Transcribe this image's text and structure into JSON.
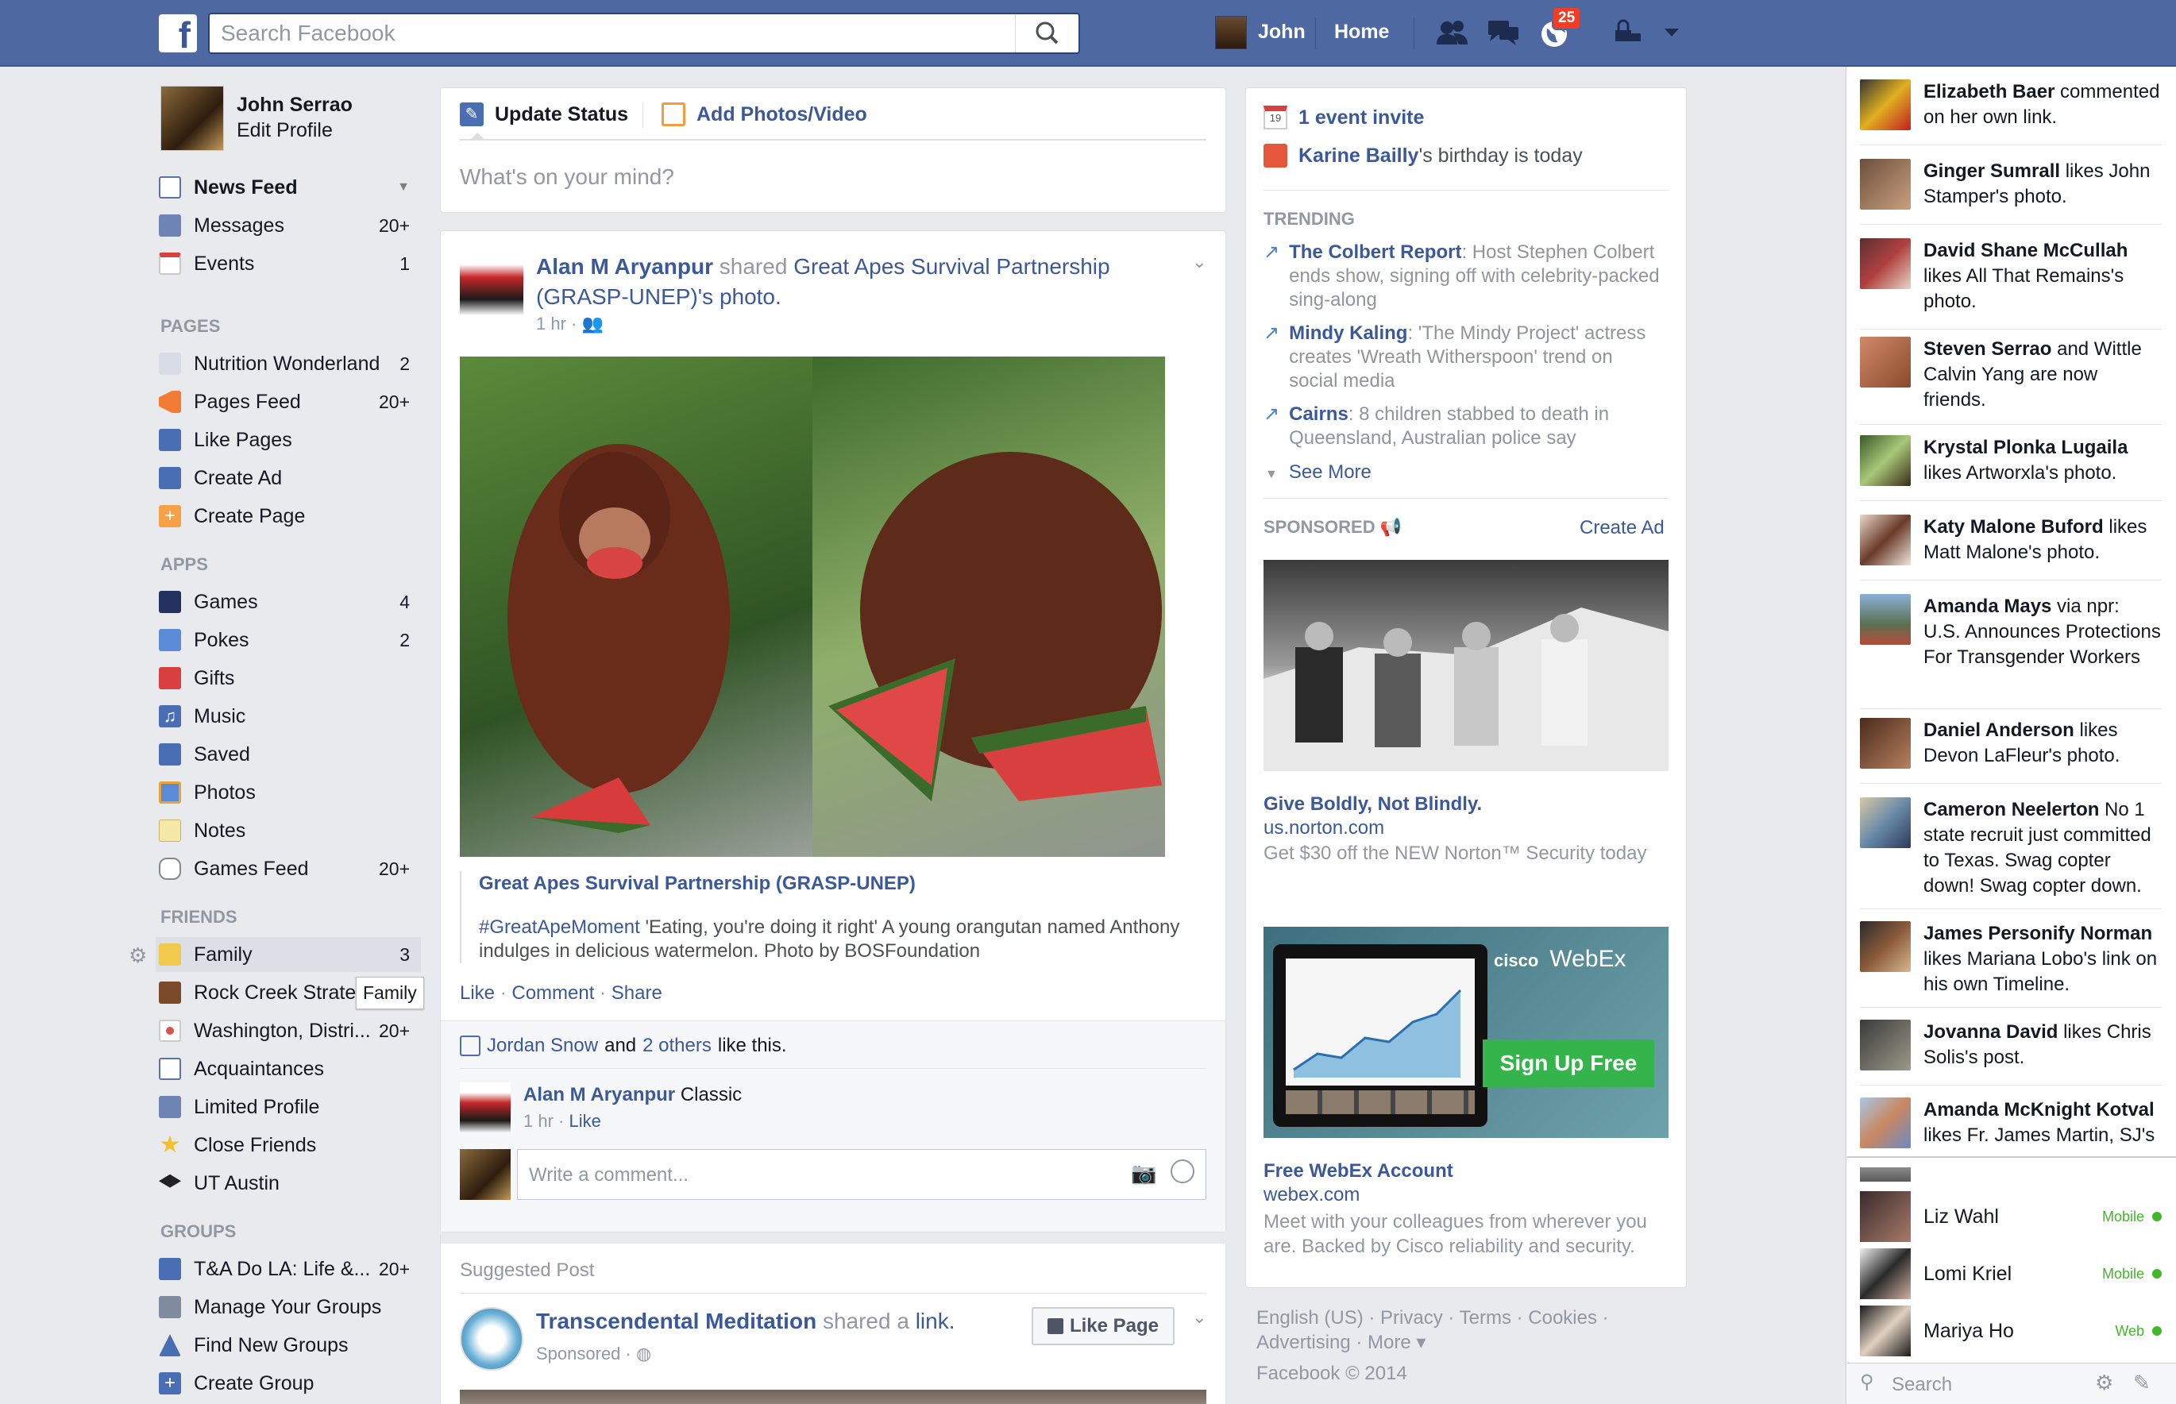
{
  "header": {
    "search_placeholder": "Search Facebook",
    "user_name": "John",
    "home_label": "Home",
    "notification_count": "25"
  },
  "profile": {
    "name": "John Serrao",
    "edit_label": "Edit Profile"
  },
  "favorites": [
    {
      "label": "News Feed",
      "count": ""
    },
    {
      "label": "Messages",
      "count": "20+"
    },
    {
      "label": "Events",
      "count": "1"
    }
  ],
  "sections": {
    "pages": "PAGES",
    "apps": "APPS",
    "friends": "FRIENDS",
    "groups": "GROUPS"
  },
  "pages": [
    {
      "label": "Nutrition Wonderland",
      "count": "2"
    },
    {
      "label": "Pages Feed",
      "count": "20+"
    },
    {
      "label": "Like Pages",
      "count": ""
    },
    {
      "label": "Create Ad",
      "count": ""
    },
    {
      "label": "Create Page",
      "count": ""
    }
  ],
  "apps": [
    {
      "label": "Games",
      "count": "4"
    },
    {
      "label": "Pokes",
      "count": "2"
    },
    {
      "label": "Gifts",
      "count": ""
    },
    {
      "label": "Music",
      "count": ""
    },
    {
      "label": "Saved",
      "count": ""
    },
    {
      "label": "Photos",
      "count": ""
    },
    {
      "label": "Notes",
      "count": ""
    },
    {
      "label": "Games Feed",
      "count": "20+"
    }
  ],
  "friends": [
    {
      "label": "Family",
      "count": "3"
    },
    {
      "label": "Rock Creek Strate",
      "count": ""
    },
    {
      "label": "Washington, Distri...",
      "count": "20+"
    },
    {
      "label": "Acquaintances",
      "count": ""
    },
    {
      "label": "Limited Profile",
      "count": ""
    },
    {
      "label": "Close Friends",
      "count": ""
    },
    {
      "label": "UT Austin",
      "count": ""
    }
  ],
  "family_tooltip": "Family",
  "groups": [
    {
      "label": "T&A Do LA: Life &...",
      "count": "20+"
    },
    {
      "label": "Manage Your Groups",
      "count": ""
    },
    {
      "label": "Find New Groups",
      "count": ""
    },
    {
      "label": "Create Group",
      "count": ""
    }
  ],
  "composer": {
    "update_status": "Update Status",
    "add_photos": "Add Photos/Video",
    "placeholder": "What's on your mind?"
  },
  "post": {
    "author": "Alan M Aryanpur",
    "shared_word": "shared",
    "page_name": "Great Apes Survival Partnership (GRASP-UNEP)",
    "possessive": "'s",
    "photo_word": "photo.",
    "time": "1 hr ·",
    "link_title": "Great Apes Survival Partnership (GRASP-UNEP)",
    "hashtag": "#GreatApeMoment",
    "caption": " 'Eating, you're doing it right' A young orangutan named Anthony indulges in delicious watermelon. Photo by BOSFoundation",
    "like": "Like",
    "comment": "Comment",
    "share": "Share",
    "likers_name": "Jordan Snow",
    "likers_and": "and",
    "likers_others": "2 others",
    "likers_suffix": "like this.",
    "comment_author": "Alan M Aryanpur",
    "comment_text": "Classic",
    "comment_time": "1 hr ·",
    "comment_like": "Like",
    "write_comment_placeholder": "Write a comment..."
  },
  "suggested": {
    "label": "Suggested Post",
    "author": "Transcendental Meditation",
    "shared_word": "shared a",
    "link_word": "link.",
    "sponsored": "Sponsored ·",
    "like_page": "Like Page"
  },
  "right": {
    "event_invite": "1 event invite",
    "birthday_name": "Karine Bailly",
    "birthday_text": "'s birthday is today",
    "trending_head": "TRENDING",
    "trending": [
      {
        "topic": "The Colbert Report",
        "text": ": Host Stephen Colbert ends show, signing off with celebrity-packed sing-along"
      },
      {
        "topic": "Mindy Kaling",
        "text": ": 'The Mindy Project' actress creates 'Wreath Witherspoon' trend on social media"
      },
      {
        "topic": "Cairns",
        "text": ": 8 children stabbed to death in Queensland, Australian police say"
      }
    ],
    "see_more": "See More",
    "sponsored_head": "SPONSORED",
    "create_ad": "Create Ad",
    "ad1": {
      "title": "Give Boldly, Not Blindly.",
      "url": "us.norton.com",
      "text": "Get $30 off the NEW Norton™ Security today"
    },
    "ad2": {
      "brand": "WebEx",
      "brand_prefix": "cisco",
      "cta": "Sign Up Free",
      "title": "Free WebEx Account",
      "url": "webex.com",
      "text": "Meet with your colleagues from wherever you are. Backed by Cisco reliability and security."
    },
    "footer_line1": "English (US) · Privacy · Terms · Cookies ·",
    "footer_line2": "Advertising · More ▾",
    "copyright": "Facebook © 2014"
  },
  "ticker": [
    {
      "name": "Elizabeth Baer",
      "text": " commented on her own link."
    },
    {
      "name": "Ginger Sumrall",
      "text": " likes John Stamper's photo."
    },
    {
      "name": "David Shane McCullah",
      "text": " likes All That Remains's photo."
    },
    {
      "name": "Steven Serrao",
      "text": " and Wittle Calvin Yang are now friends."
    },
    {
      "name": "Krystal Plonka Lugaila",
      "text": " likes Artworxla's photo."
    },
    {
      "name": "Katy Malone Buford",
      "text": " likes Matt Malone's photo."
    },
    {
      "name": "Amanda Mays",
      "text": " via npr: U.S. Announces Protections For Transgender Workers"
    },
    {
      "name": "Daniel Anderson",
      "text": " likes Devon LaFleur's photo."
    },
    {
      "name": "Cameron Neelerton",
      "text": " No 1 state recruit just committed to Texas. Swag copter down! Swag copter down."
    },
    {
      "name": "James Personify Norman",
      "text": " likes Mariana Lobo's link on his own Timeline."
    },
    {
      "name": "Jovanna David",
      "text": " likes Chris Solis's post."
    },
    {
      "name": "Amanda McKnight Kotval",
      "text": " likes Fr. James Martin, SJ's"
    }
  ],
  "chat": [
    {
      "name": "Liz Wahl",
      "status": "Mobile"
    },
    {
      "name": "Lomi Kriel",
      "status": "Mobile"
    },
    {
      "name": "Mariya Ho",
      "status": "Web"
    }
  ],
  "chat_search_placeholder": "Search"
}
